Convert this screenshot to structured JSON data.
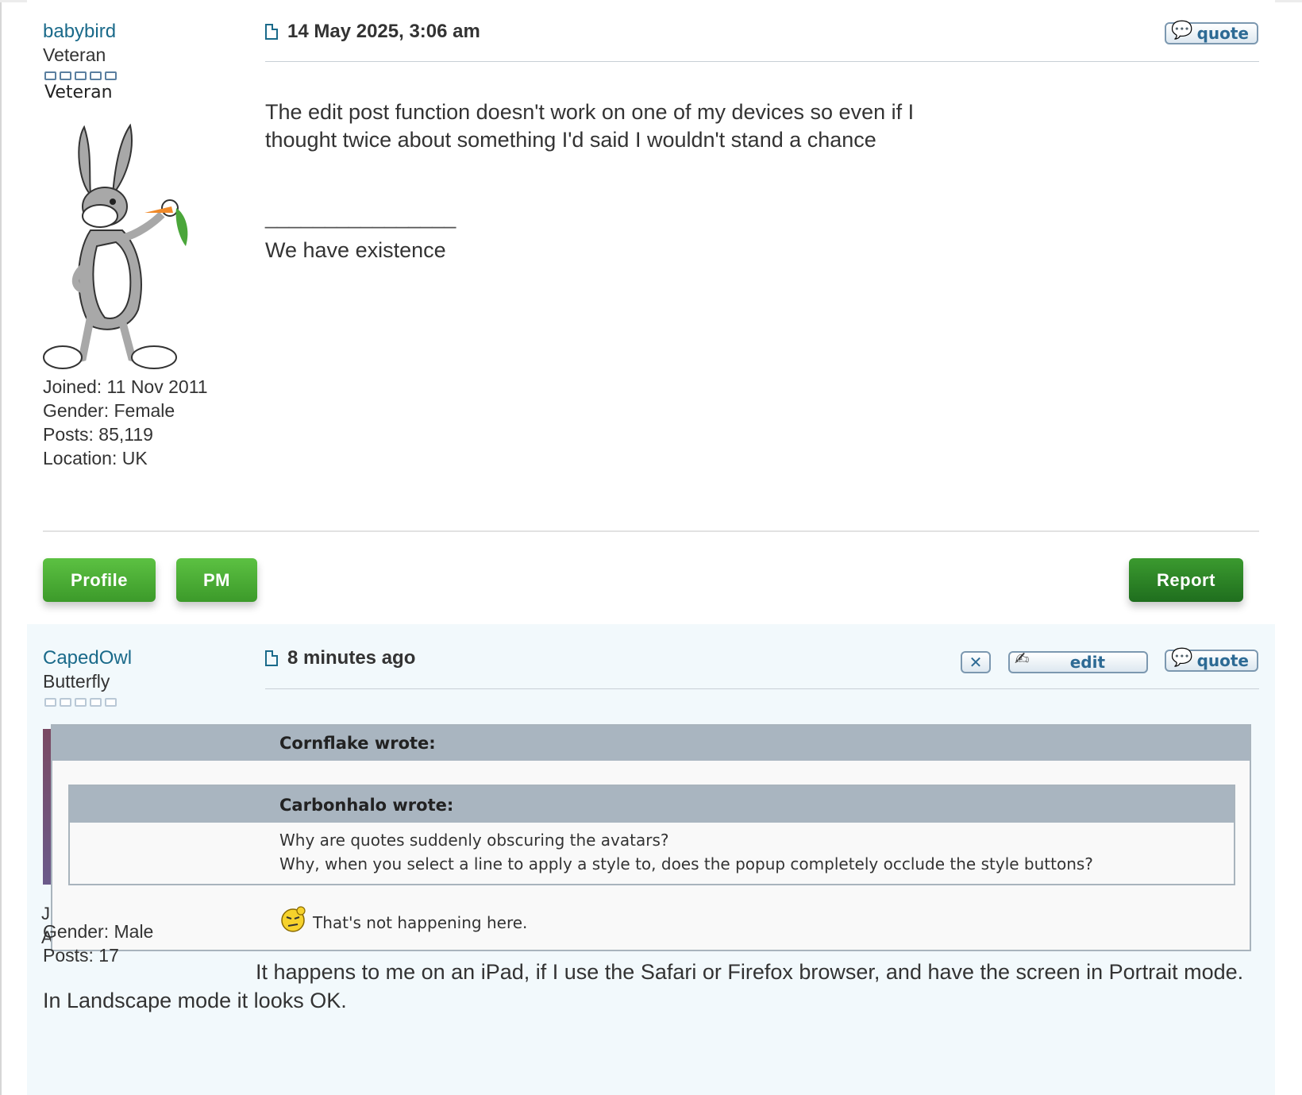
{
  "post1": {
    "username": "babybird",
    "rank_title": "Veteran",
    "rank_image_text": "Veteran",
    "date": "14 May 2025, 3:06 am",
    "quote_label": "quote",
    "avatar_icon": "bugs-bunny-avatar",
    "joined": "Joined: 11 Nov 2011",
    "gender": "Gender: Female",
    "posts": "Posts: 85,119",
    "location": "Location: UK",
    "body_line1": "The edit post function doesn't work on one of my devices so even if I",
    "body_line2": "thought twice about something I'd said I wouldn't stand a chance",
    "sig_rule": "________________",
    "signature": "We have existence",
    "buttons": {
      "profile": "Profile",
      "pm": "PM",
      "report": "Report"
    }
  },
  "post2": {
    "username": "CapedOwl",
    "rank_title": "Butterfly",
    "date": "8 minutes ago",
    "delete_label": "✕",
    "edit_label": "edit",
    "quote_label": "quote",
    "gender": "Gender: Male",
    "posts": "Posts: 17",
    "quote": {
      "author_line": "Cornflake wrote:",
      "nested_author_line": "Carbonhalo wrote:",
      "nested_line1": "Why are quotes suddenly obscuring the avatars?",
      "nested_line2": "Why, when you select a line to apply a style to, does the popup completely occlude the style buttons?",
      "reply": "That's not happening here."
    },
    "body": "It happens to me on an iPad, if I use the Safari or Firefox browser, and have the screen in Portrait mode. In Landscape mode it looks OK."
  },
  "colors": {
    "username": "#1a6a8a",
    "green_button": "#4caf35",
    "report_button": "#2a7f22",
    "quote_header": "#a9b5c0",
    "post_alt_bg": "#f2f9fc"
  }
}
